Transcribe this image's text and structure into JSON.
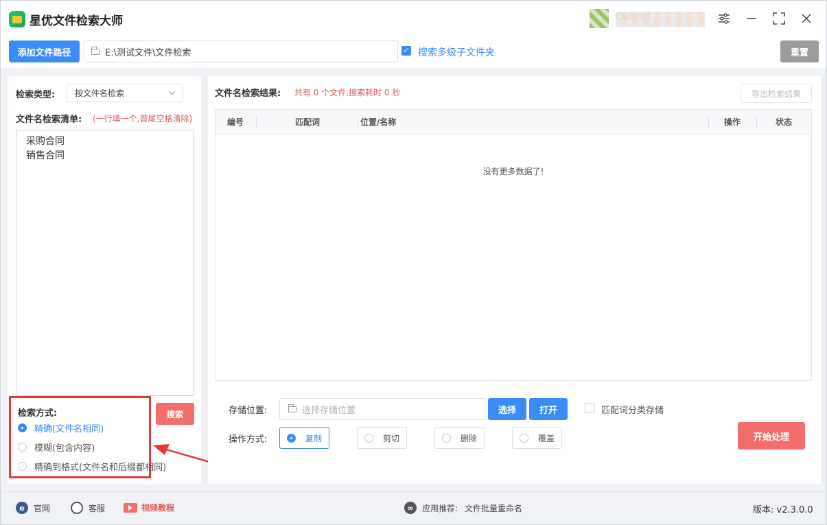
{
  "app": {
    "title": "星优文件检索大师",
    "username": "Cwbhcf",
    "window_icons": {
      "settings": "sliders-icon",
      "minimize": "minimize-icon",
      "maximize": "maximize-icon",
      "close": "close-icon"
    }
  },
  "pathbar": {
    "add_path_label": "添加文件路径",
    "path_value": "E:\\测试文件\\文件检索",
    "subfolder_checked": true,
    "subfolder_label": "搜索多级子文件夹",
    "reset_label": "重置"
  },
  "left": {
    "search_type_label": "检索类型:",
    "search_type_value": "按文件名检索",
    "list_label": "文件名检索清单:",
    "list_hint": "(一行填一个,首尾空格清除)",
    "list_items": "采购合同\n销售合同",
    "method_label": "检索方式:",
    "methods": [
      {
        "label": "精确(文件名相同)",
        "selected": true
      },
      {
        "label": "模糊(包含内容)",
        "selected": false
      },
      {
        "label": "精确到格式(文件名和后缀都相同)",
        "selected": false
      }
    ],
    "search_label": "搜索"
  },
  "right": {
    "result_label": "文件名检索结果:",
    "result_summary": "共有 0 个文件,搜索耗时 0 秒",
    "export_label": "导出检索结果",
    "columns": [
      "编号",
      "匹配词",
      "位置/名称",
      "操作",
      "状态"
    ],
    "empty_message": "没有更多数据了!",
    "store_label": "存储位置:",
    "store_placeholder": "选择存储位置",
    "select_label": "选择",
    "open_label": "打开",
    "classify_label": "匹配词分类存储",
    "op_label": "操作方式:",
    "ops": [
      {
        "label": "复制",
        "selected": true
      },
      {
        "label": "剪切",
        "selected": false
      },
      {
        "label": "删除",
        "selected": false
      },
      {
        "label": "覆盖",
        "selected": false
      }
    ],
    "start_label": "开始处理"
  },
  "footer": {
    "site": "官网",
    "service": "客服",
    "video": "视频教程",
    "recommend_label": "应用推荐:",
    "recommend_app": "文件批量重命名",
    "version": "版本:  v2.3.0.0"
  },
  "colors": {
    "primary": "#3c8cf5",
    "danger": "#f36d6d",
    "annotation": "#e53935"
  }
}
